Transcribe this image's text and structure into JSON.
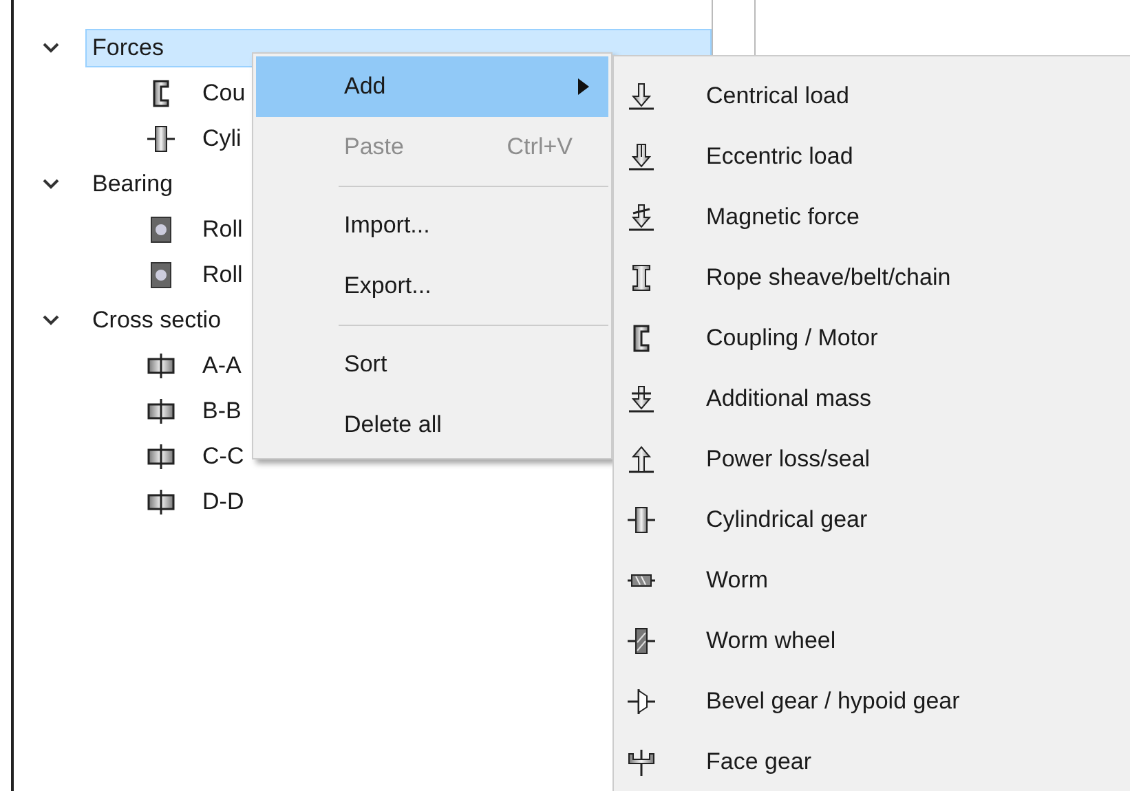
{
  "tree": {
    "items": [
      {
        "label": "Forces",
        "expanded": true,
        "selected": true,
        "children": [
          {
            "label": "Cou",
            "kind": "coupling",
            "selected": false
          },
          {
            "label": "Cyli",
            "kind": "cylgear",
            "selected": false
          }
        ]
      },
      {
        "label": "Bearing",
        "expanded": true,
        "selected": false,
        "children": [
          {
            "label": "Roll",
            "kind": "bearing",
            "selected": false
          },
          {
            "label": "Roll",
            "kind": "bearing",
            "selected": false
          }
        ]
      },
      {
        "label": "Cross sectio",
        "expanded": true,
        "selected": false,
        "children": [
          {
            "label": "A-A",
            "kind": "section",
            "selected": false
          },
          {
            "label": "B-B",
            "kind": "section",
            "selected": false
          },
          {
            "label": "C-C",
            "kind": "section",
            "selected": false
          },
          {
            "label": "D-D",
            "kind": "section",
            "selected": false
          }
        ]
      }
    ]
  },
  "context_menu": {
    "items": [
      {
        "kind": "item",
        "label": "Add",
        "selected": true,
        "disabled": false,
        "submenu": true
      },
      {
        "kind": "item",
        "label": "Paste",
        "shortcut": "Ctrl+V",
        "selected": false,
        "disabled": true,
        "submenu": false
      },
      {
        "kind": "separator"
      },
      {
        "kind": "item",
        "label": "Import...",
        "selected": false,
        "disabled": false,
        "submenu": false
      },
      {
        "kind": "item",
        "label": "Export...",
        "selected": false,
        "disabled": false,
        "submenu": false
      },
      {
        "kind": "separator"
      },
      {
        "kind": "item",
        "label": "Sort",
        "selected": false,
        "disabled": false,
        "submenu": false
      },
      {
        "kind": "item",
        "label": "Delete all",
        "selected": false,
        "disabled": false,
        "submenu": false
      }
    ]
  },
  "submenu": {
    "items": [
      {
        "label": "Centrical load",
        "kind": "central"
      },
      {
        "label": "Eccentric load",
        "kind": "eccentric"
      },
      {
        "label": "Magnetic force",
        "kind": "magnetic"
      },
      {
        "label": "Rope sheave/belt/chain",
        "kind": "sheave"
      },
      {
        "label": "Coupling / Motor",
        "kind": "coupling"
      },
      {
        "label": "Additional mass",
        "kind": "mass"
      },
      {
        "label": "Power loss/seal",
        "kind": "loss"
      },
      {
        "label": "Cylindrical gear",
        "kind": "cylgear"
      },
      {
        "label": "Worm",
        "kind": "worm"
      },
      {
        "label": "Worm wheel",
        "kind": "wormwheel"
      },
      {
        "label": "Bevel gear / hypoid gear",
        "kind": "bevel"
      },
      {
        "label": "Face gear",
        "kind": "face"
      }
    ]
  }
}
